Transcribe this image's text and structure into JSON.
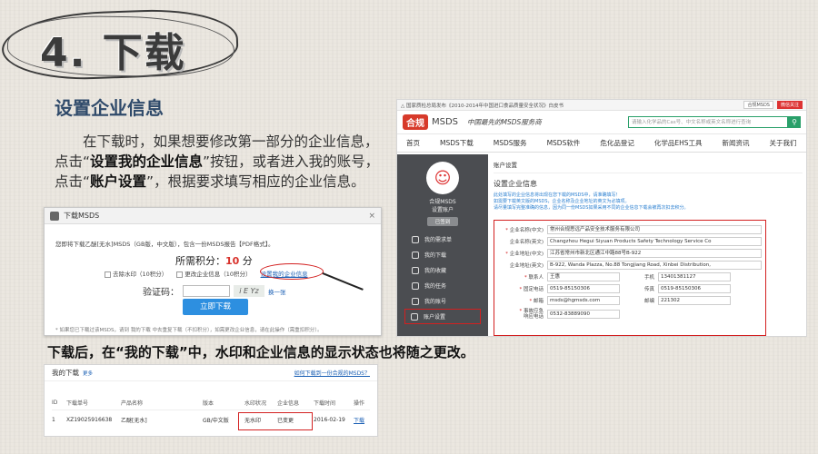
{
  "slide": {
    "title": "4. 下载",
    "section_title": "设置企业信息",
    "desc_1": "在下载时，如果想要修改第一部分的企业信息，点击“",
    "desc_b1": "设置我的企业信息",
    "desc_2": "”按钮，或者进入我的账号，点击“",
    "desc_b2": "账户设置",
    "desc_3": "”，根据要求填写相应的企业信息。",
    "caption": "下载后，在“我的下载”中，水印和企业信息的显示状态也将随之更改。"
  },
  "dialog": {
    "title": "下载MSDS",
    "close": "×",
    "line": "您即将下载乙醚[无水]MSDS（GB版，中文版），包含一份MSDS报告【PDF格式】。",
    "points_label": "所需积分：",
    "points_value": "10",
    "points_unit": " 分",
    "opt1": "去除水印（10积分）",
    "opt2": "更改企业信息（10积分）",
    "opt3": "设置我的企业信息",
    "verify_label": "验证码：",
    "captcha": "i E Yz",
    "swap": "换一张",
    "btn": "立即下载",
    "note": "* 如果您已下载过该MSDS，请到 我的下载 中去重复下载（不扣积分），如需更改企业信息，请在此操作（需重扣积分）。"
  },
  "site": {
    "topbar_text": "△ 国家质检总局发布《2010-2014年中国进口食品质量安全状况》白皮书",
    "tb_btn1": "合规MSDS",
    "tb_btn2": "微信关注",
    "logo": "合规",
    "logo_text": "MSDS",
    "slogan": "中国最先的MSDS服务商",
    "search_placeholder": "请输入化学品的Cas号、中文名称或英文名称进行查询",
    "search_icon": "search-icon",
    "nav": [
      "首页",
      "MSDS下载",
      "MSDS服务",
      "MSDS软件",
      "危化品登记",
      "化学品EHS工具",
      "新闻资讯",
      "关于我们"
    ],
    "user_name": "合规MSDS",
    "user_sub": "设置账户",
    "user_tag": "已签到",
    "menu": [
      "我的需求单",
      "我的下载",
      "我的收藏",
      "我的任务",
      "我的账号",
      "账户设置"
    ],
    "crumb": "账户设置",
    "sub": "设置企业信息",
    "note1": "此处填写的企业信息将出现在您下载的MSDS中，请准确填写！",
    "note2": "如需要下载英文版的MSDS，企业名称及企业地址的英文为必填项。",
    "note3": "请尽量填写完整准确的信息，因为同一份MSDS如果采用不同的企业信息下载会被再次扣去积分。",
    "fields": {
      "cn_name_label": "企业名称(中文)",
      "cn_name": "常州合规思远产品安全技术服务有限公司",
      "en_name_label": "企业名称(英文)",
      "en_name": "Changzhou Hegui Siyuan Products Safety Technology Service Co",
      "cn_addr_label": "企业地址(中文)",
      "cn_addr": "江苏省常州市新北区通江中路88号B-922",
      "en_addr_label": "企业地址(英文)",
      "en_addr": "B-922, Wanda Plazza, No.88 Tongjiang Road, Xinbei Distribution,",
      "contact_label": "联系人",
      "contact": "王惠",
      "mobile_label": "手机",
      "mobile": "13401381127",
      "phone_label": "固定电话",
      "phone": "0519-85150306",
      "fax_label": "传真",
      "fax": "0519-85150306",
      "email_label": "邮箱",
      "email": "msds@hgmsds.com",
      "zip_label": "邮编",
      "zip": "221302",
      "emergency_label": "事故应急\n响应电话",
      "emergency": "0532-83889090"
    }
  },
  "downloads": {
    "title": "我的下载",
    "more": "更多",
    "howto": "如何下载到一份合规的MSDS？",
    "headers": [
      "ID",
      "下载单号",
      "产品名称",
      "版本",
      "水印状况",
      "企业信息",
      "下载时间",
      "操作"
    ],
    "row": [
      "1",
      "XZ19025916638",
      "乙醚[无水]",
      "GB/中文版",
      "无水印",
      "已变更",
      "2016-02-19",
      "下载"
    ]
  }
}
